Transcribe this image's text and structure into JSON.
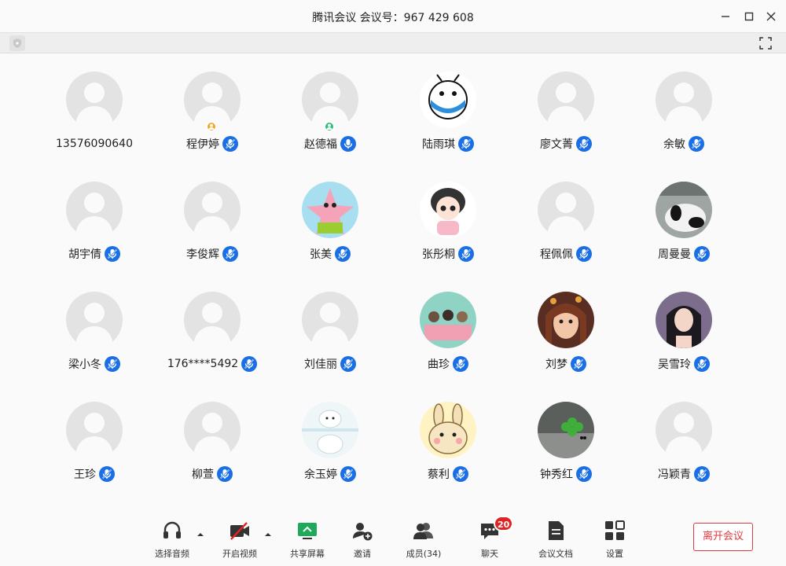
{
  "window": {
    "title": "腾讯会议 会议号：967 429 608"
  },
  "participants": [
    {
      "name": "13576090640",
      "avatar": "default",
      "mic": "none"
    },
    {
      "name": "程伊婷",
      "avatar": "default",
      "mic": "muted",
      "badge": "host"
    },
    {
      "name": "赵德福",
      "avatar": "default",
      "mic": "on",
      "badge": "cohost"
    },
    {
      "name": "陆雨琪",
      "avatar": "cartoon-bug",
      "mic": "muted"
    },
    {
      "name": "廖文菁",
      "avatar": "default",
      "mic": "muted"
    },
    {
      "name": "余敏",
      "avatar": "default",
      "mic": "muted"
    },
    {
      "name": "胡宇倩",
      "avatar": "default",
      "mic": "muted"
    },
    {
      "name": "李俊辉",
      "avatar": "default",
      "mic": "muted"
    },
    {
      "name": "张美",
      "avatar": "cartoon-star",
      "mic": "muted"
    },
    {
      "name": "张彤桐",
      "avatar": "cartoon-girl",
      "mic": "muted"
    },
    {
      "name": "程佩佩",
      "avatar": "default",
      "mic": "muted"
    },
    {
      "name": "周曼曼",
      "avatar": "photo-panda",
      "mic": "muted"
    },
    {
      "name": "梁小冬",
      "avatar": "default",
      "mic": "muted"
    },
    {
      "name": "176****5492",
      "avatar": "default",
      "mic": "muted"
    },
    {
      "name": "刘佳丽",
      "avatar": "default",
      "mic": "muted"
    },
    {
      "name": "曲珍",
      "avatar": "illustration-group",
      "mic": "muted"
    },
    {
      "name": "刘梦",
      "avatar": "illustration-girl",
      "mic": "muted"
    },
    {
      "name": "吴雪玲",
      "avatar": "photo-woman",
      "mic": "muted"
    },
    {
      "name": "王珍",
      "avatar": "default",
      "mic": "muted"
    },
    {
      "name": "柳萱",
      "avatar": "default",
      "mic": "muted"
    },
    {
      "name": "余玉婷",
      "avatar": "cartoon-bear",
      "mic": "muted"
    },
    {
      "name": "蔡利",
      "avatar": "cartoon-bunny",
      "mic": "muted"
    },
    {
      "name": "钟秀红",
      "avatar": "photo-clover",
      "mic": "muted"
    },
    {
      "name": "冯颖青",
      "avatar": "default",
      "mic": "muted"
    }
  ],
  "toolbar": {
    "audio": "选择音频",
    "video": "开启视频",
    "share": "共享屏幕",
    "invite": "邀请",
    "members": "成员(34)",
    "chat": "聊天",
    "chat_badge": "20",
    "docs": "会议文档",
    "settings": "设置",
    "leave": "离开会议"
  },
  "colors": {
    "accent": "#1a6fe6",
    "leave": "#e0393e",
    "share_green": "#1eaa5a",
    "badge_red": "#e02424",
    "host_orange": "#f5a623",
    "cohost_green": "#2bbf7a"
  }
}
